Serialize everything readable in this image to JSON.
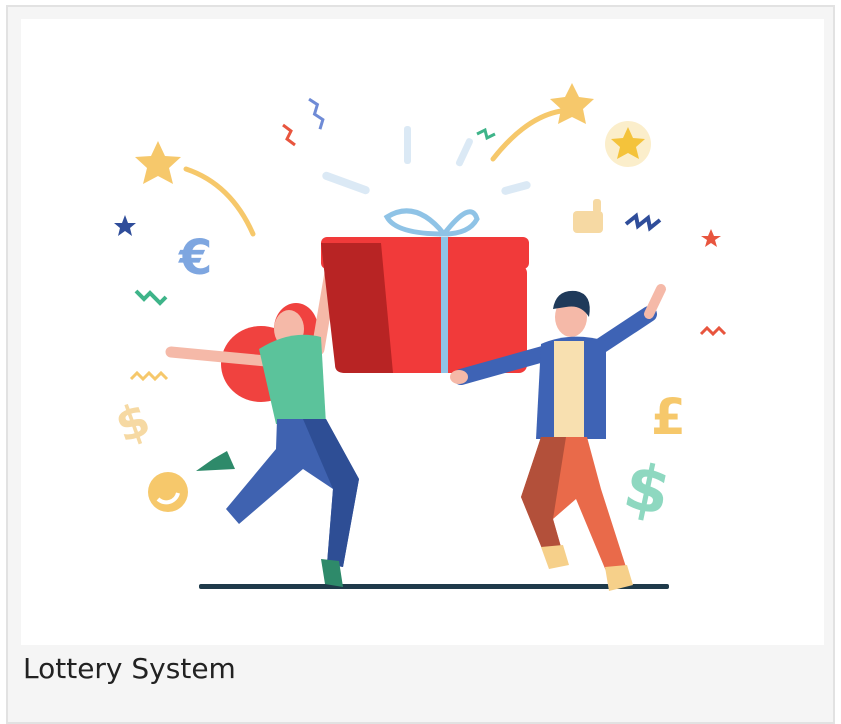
{
  "card": {
    "title": "Lottery System"
  },
  "illustration": {
    "description_icon": "celebration-gift-icon",
    "colors": {
      "gift": "#f13a3a",
      "gift_dark": "#b82424",
      "ribbon": "#8fc3e6",
      "star": "#f6c86b",
      "woman_hair": "#f0423f",
      "woman_top": "#5bc39b",
      "woman_pants": "#3f62b0",
      "man_jacket": "#3e63b5",
      "man_pants": "#e96a4a",
      "ground": "#1f3a4a"
    }
  }
}
